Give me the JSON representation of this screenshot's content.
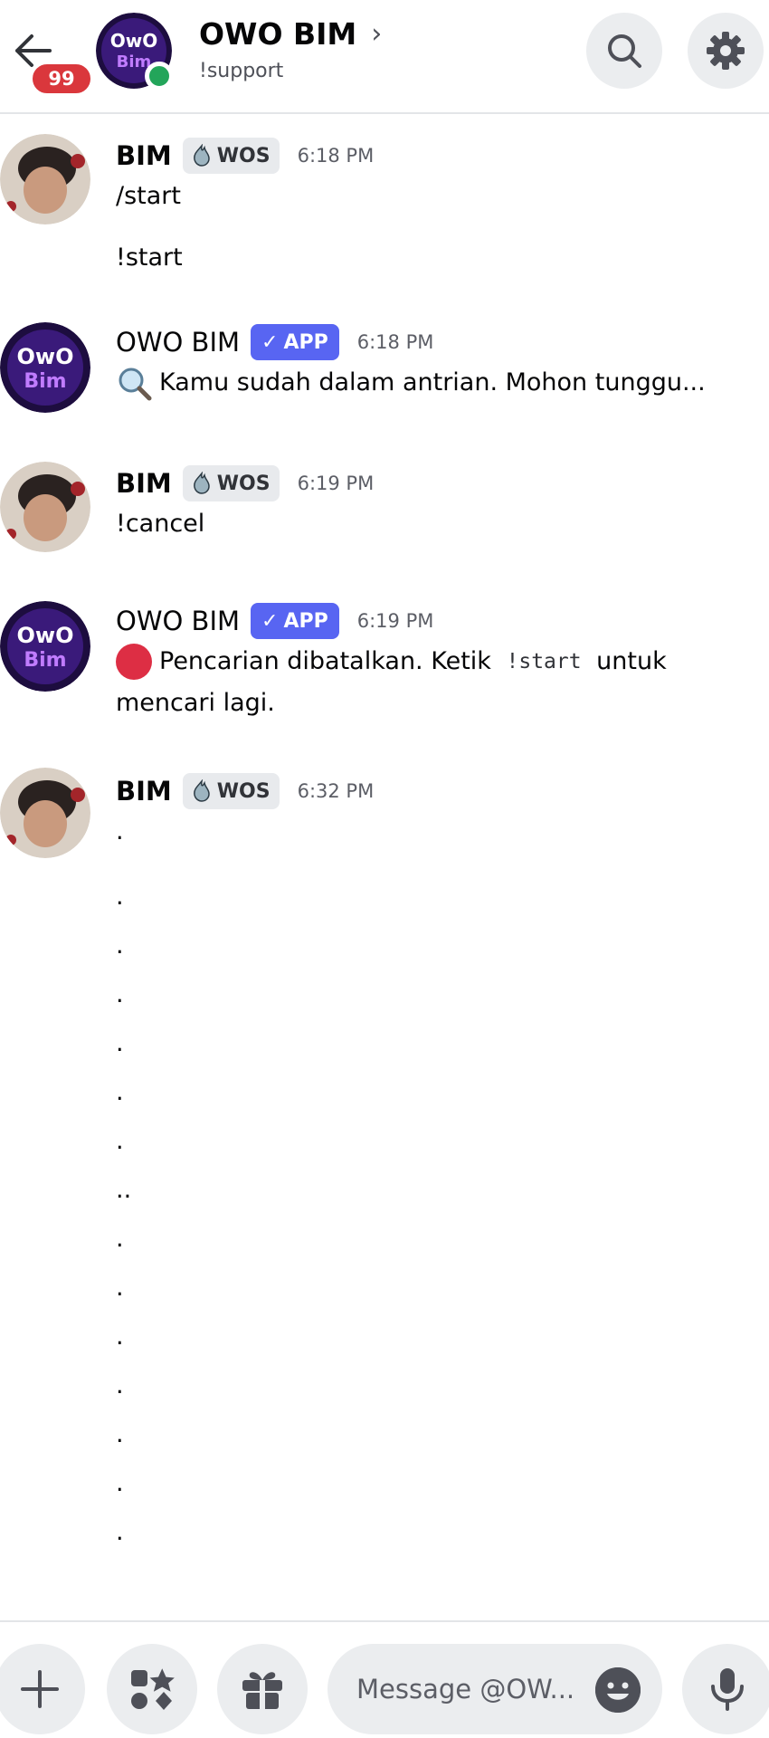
{
  "header": {
    "title": "OWO BIM",
    "subtitle": "!support",
    "unread_badge": "99",
    "back_icon": "arrow-left-icon",
    "search_icon": "search-icon",
    "settings_icon": "gear-icon"
  },
  "messages": [
    {
      "author": "BIM",
      "tag": "WOS",
      "time": "6:18 PM",
      "lines": [
        "/start",
        "!start"
      ]
    },
    {
      "author": "OWO BIM",
      "tag": "APP",
      "time": "6:18 PM",
      "text": "Kamu sudah dalam antrian. Mohon tunggu...",
      "emoji": "magnifier-icon"
    },
    {
      "author": "BIM",
      "tag": "WOS",
      "time": "6:19 PM",
      "text": "!cancel"
    },
    {
      "author": "OWO BIM",
      "tag": "APP",
      "time": "6:19 PM",
      "text_before": "Pencarian dibatalkan. Ketik ",
      "code": "!start",
      "text_after": " untuk",
      "text_line2": "mencari lagi.",
      "emoji": "red-circle-icon"
    },
    {
      "author": "BIM",
      "tag": "WOS",
      "time": "6:32 PM",
      "dots": [
        ".",
        ".",
        ".",
        ".",
        ".",
        ".",
        ".",
        "..",
        ".",
        ".",
        ".",
        ".",
        ".",
        ".",
        "."
      ]
    }
  ],
  "composer": {
    "placeholder": "Message @OW...",
    "plus_icon": "plus-icon",
    "apps_icon": "apps-icon",
    "gift_icon": "gift-icon",
    "emoji_icon": "emoji-icon",
    "mic_icon": "microphone-icon"
  },
  "colors": {
    "app_tag": "#5865f2",
    "online": "#23a55a",
    "badge": "#da373c"
  }
}
